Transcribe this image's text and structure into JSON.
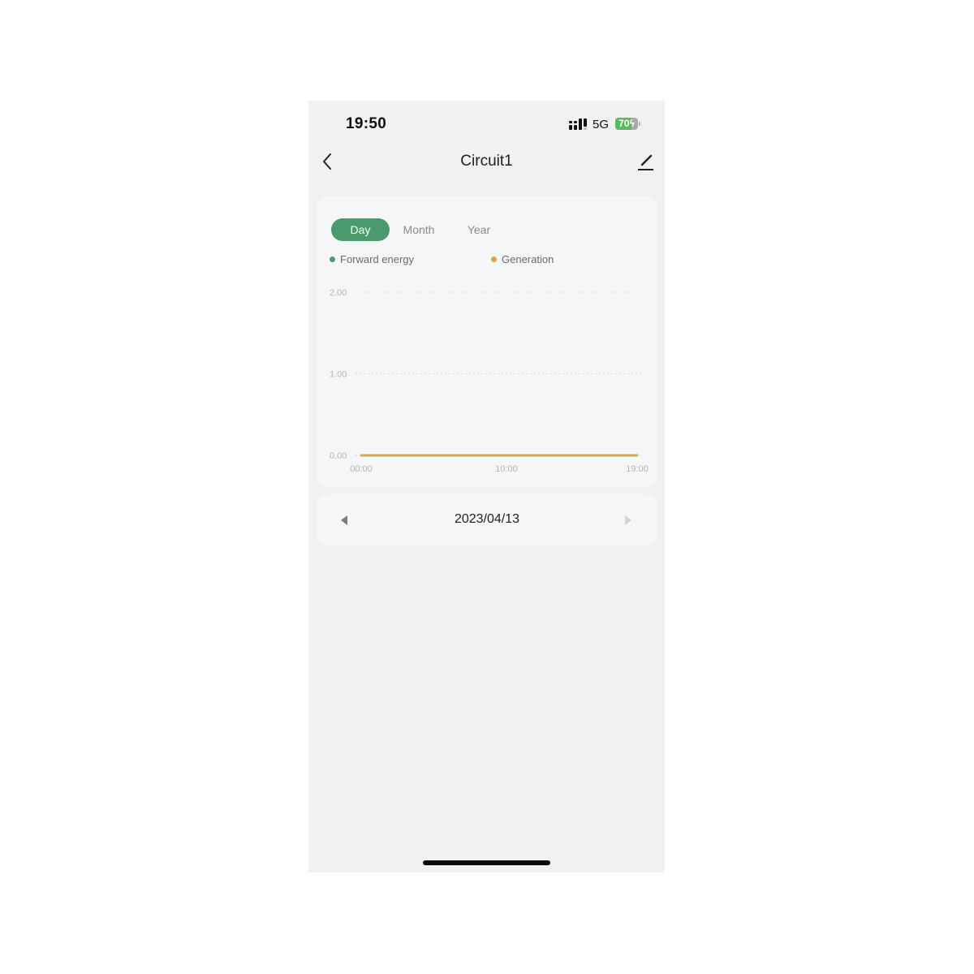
{
  "status_bar": {
    "time": "19:50",
    "network": "5G",
    "battery_percent": 70,
    "battery_label": "70",
    "signal_icon": "cellular-signal-icon",
    "charging_icon": "bolt-icon"
  },
  "nav": {
    "title": "Circuit1",
    "back_icon": "chevron-left-icon",
    "edit_icon": "pencil-icon"
  },
  "tabs": [
    {
      "label": "Day",
      "active": true
    },
    {
      "label": "Month",
      "active": false
    },
    {
      "label": "Year",
      "active": false
    }
  ],
  "legend": [
    {
      "label": "Forward energy",
      "color": "#4a9a6e"
    },
    {
      "label": "Generation",
      "color": "#e0a048"
    }
  ],
  "chart_data": {
    "type": "line",
    "title": "",
    "xlabel": "",
    "ylabel": "",
    "x": [
      "00:00",
      "10:00",
      "19:00"
    ],
    "x_range": [
      0,
      19
    ],
    "x_ticks": [
      {
        "value": 0,
        "label": "00:00"
      },
      {
        "value": 10,
        "label": "10:00"
      },
      {
        "value": 19,
        "label": "19:00"
      }
    ],
    "y_ticks": [
      {
        "value": 0,
        "label": "0.00"
      },
      {
        "value": 1,
        "label": "1.00"
      },
      {
        "value": 2,
        "label": "2.00"
      }
    ],
    "ylim": [
      0,
      2
    ],
    "grid": true,
    "legend_position": "top",
    "series": [
      {
        "name": "Forward energy",
        "color": "#4a9a6e",
        "x": [
          0,
          19
        ],
        "values": [
          0,
          0
        ]
      },
      {
        "name": "Generation",
        "color": "#d8a650",
        "x": [
          0,
          19
        ],
        "values": [
          0,
          0
        ]
      }
    ]
  },
  "date_picker": {
    "date": "2023/04/13",
    "prev_icon": "triangle-left-icon",
    "next_icon": "triangle-right-icon"
  }
}
